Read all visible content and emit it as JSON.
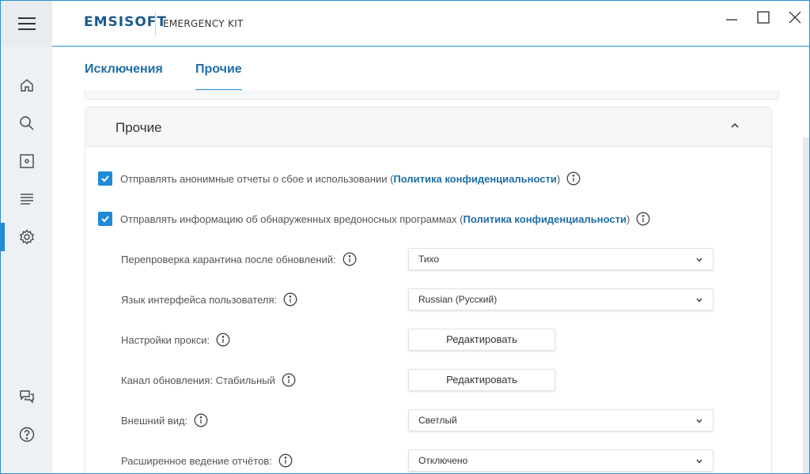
{
  "app": {
    "logo": "EMSISOFT",
    "product": "EMERGENCY KIT"
  },
  "window": {
    "minimize_icon": "minimize-icon",
    "maximize_icon": "maximize-icon",
    "close_icon": "close-icon"
  },
  "sidebar": {
    "items": [
      {
        "icon": "home-icon"
      },
      {
        "icon": "search-icon"
      },
      {
        "icon": "quarantine-icon"
      },
      {
        "icon": "logs-icon"
      },
      {
        "icon": "settings-icon",
        "active": true
      },
      {
        "icon": "chat-icon"
      },
      {
        "icon": "help-icon"
      }
    ]
  },
  "tabs": [
    {
      "label": "Исключения"
    },
    {
      "label": "Прочие",
      "active": true
    }
  ],
  "section": {
    "title": "Прочие"
  },
  "checks": [
    {
      "text": "Отправлять анонимные отчеты о сбое и использовании (",
      "link": "Политика конфиденциальности",
      "tail": ")",
      "checked": true
    },
    {
      "text": "Отправлять информацию об обнаруженных вредоносных программах (",
      "link": "Политика конфиденциальности",
      "tail": ")",
      "checked": true
    }
  ],
  "settings": [
    {
      "label": "Перепроверка карантина после обновлений:",
      "type": "select",
      "value": "Тихо"
    },
    {
      "label": "Язык интерфейса пользователя:",
      "type": "select",
      "value": "Russian (Русский)"
    },
    {
      "label": "Настройки прокси:",
      "type": "button",
      "value": "Редактировать"
    },
    {
      "label": "Канал обновления: Стабильный",
      "type": "button",
      "value": "Редактировать"
    },
    {
      "label": "Внешний вид:",
      "type": "select",
      "value": "Светлый"
    },
    {
      "label": "Расширенное ведение отчётов:",
      "type": "select",
      "value": "Отключено"
    }
  ],
  "colors": {
    "accent": "#1f8ad6",
    "link": "#1f6ea8"
  }
}
